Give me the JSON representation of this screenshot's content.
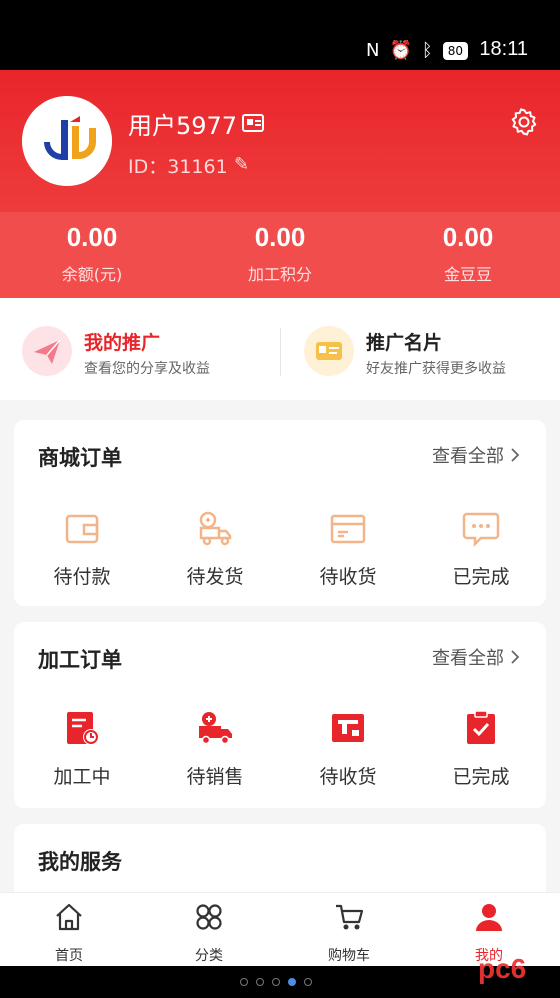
{
  "status_bar": {
    "time": "18:11",
    "battery": "80",
    "icons": [
      "nfc-icon",
      "alarm-icon",
      "bluetooth-icon",
      "battery-icon"
    ]
  },
  "profile": {
    "username": "用户5977",
    "user_id": "ID：31161"
  },
  "balances": [
    {
      "value": "0.00",
      "label": "余额(元)"
    },
    {
      "value": "0.00",
      "label": "加工积分"
    },
    {
      "value": "0.00",
      "label": "金豆豆"
    }
  ],
  "promo": [
    {
      "title": "我的推广",
      "subtitle": "查看您的分享及收益",
      "title_color": "#e8252b"
    },
    {
      "title": "推广名片",
      "subtitle": "好友推广获得更多收益",
      "title_color": "#222222"
    }
  ],
  "mall_orders": {
    "title": "商城订单",
    "view_all": "查看全部",
    "items": [
      {
        "label": "待付款",
        "icon": "wallet-icon"
      },
      {
        "label": "待发货",
        "icon": "delivery-truck-icon"
      },
      {
        "label": "待收货",
        "icon": "package-icon"
      },
      {
        "label": "已完成",
        "icon": "chat-bubble-icon"
      }
    ]
  },
  "processing_orders": {
    "title": "加工订单",
    "view_all": "查看全部",
    "items": [
      {
        "label": "加工中",
        "icon": "document-clock-icon"
      },
      {
        "label": "待销售",
        "icon": "sale-truck-icon"
      },
      {
        "label": "待收货",
        "icon": "receive-box-icon"
      },
      {
        "label": "已完成",
        "icon": "clipboard-check-icon"
      }
    ]
  },
  "services": {
    "title": "我的服务"
  },
  "bottom_nav": [
    {
      "label": "首页",
      "icon": "home-icon",
      "active": false
    },
    {
      "label": "分类",
      "icon": "category-icon",
      "active": false
    },
    {
      "label": "购物车",
      "icon": "cart-icon",
      "active": false
    },
    {
      "label": "我的",
      "icon": "profile-icon",
      "active": true
    }
  ],
  "colors": {
    "brand_red": "#e8252b",
    "icon_orange": "#f2b58a",
    "active_nav": "#e8252b"
  }
}
